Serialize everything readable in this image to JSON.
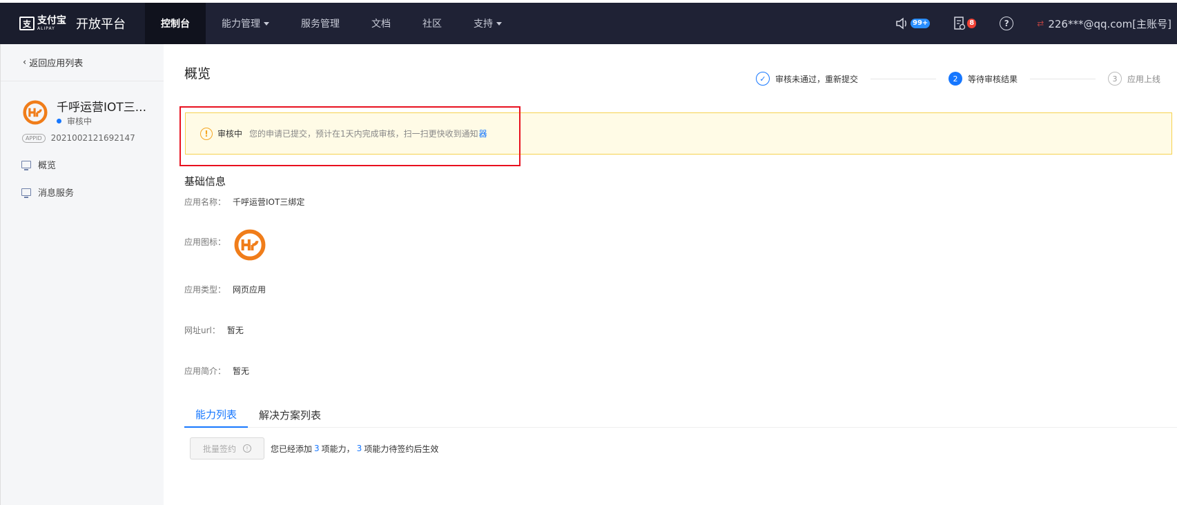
{
  "header": {
    "logo_cn": "支付宝",
    "logo_en": "ALIPAY",
    "platform_title": "开放平台",
    "nav": [
      {
        "label": "控制台",
        "active": true,
        "dropdown": false
      },
      {
        "label": "能力管理",
        "active": false,
        "dropdown": true
      },
      {
        "label": "服务管理",
        "active": false,
        "dropdown": false
      },
      {
        "label": "文档",
        "active": false,
        "dropdown": false
      },
      {
        "label": "社区",
        "active": false,
        "dropdown": false
      },
      {
        "label": "支持",
        "active": false,
        "dropdown": true
      }
    ],
    "notifications_badge": "99+",
    "messages_badge": "8",
    "help_symbol": "?",
    "account": "226***@qq.com[主账号]"
  },
  "sidebar": {
    "back_label": "返回应用列表",
    "app_name": "千呼运营IOT三...",
    "app_status": "审核中",
    "appid_tag": "APPID",
    "appid": "2021002121692147",
    "menu": [
      {
        "label": "概览",
        "icon": "monitor-icon"
      },
      {
        "label": "消息服务",
        "icon": "chart-icon"
      }
    ]
  },
  "main": {
    "title": "概览",
    "steps": [
      {
        "symbol": "✓",
        "label": "审核未通过，重新提交",
        "state": "done"
      },
      {
        "symbol": "2",
        "label": "等待审核结果",
        "state": "current"
      },
      {
        "symbol": "3",
        "label": "应用上线",
        "state": "todo"
      }
    ],
    "alert": {
      "icon": "!",
      "title": "审核中",
      "text": "您的申请已提交，预计在1天内完成审核，扫一扫更快收到通知",
      "link": "器"
    },
    "basic_info_title": "基础信息",
    "info": {
      "name_label": "应用名称：",
      "name_value": "千呼运营IOT三绑定",
      "icon_label": "应用图标：",
      "type_label": "应用类型：",
      "type_value": "网页应用",
      "url_label": "网址url：",
      "url_value": "暂无",
      "desc_label": "应用简介：",
      "desc_value": "暂无"
    },
    "tabs": [
      {
        "label": "能力列表",
        "active": true
      },
      {
        "label": "解决方案列表",
        "active": false
      }
    ],
    "batch": {
      "button_label": "批量签约",
      "info_symbol": "!",
      "text_prefix": "您已经添加",
      "added_count": "3",
      "text_mid": "项能力，",
      "pending_count": "3",
      "text_suffix": "项能力待签约后生效"
    }
  },
  "colors": {
    "header_bg": "#1f2235",
    "accent": "#1677ff",
    "highlight_box": "#e8101e",
    "alert_bg": "#fffbe6",
    "logo_orange": "#f07d1a"
  }
}
